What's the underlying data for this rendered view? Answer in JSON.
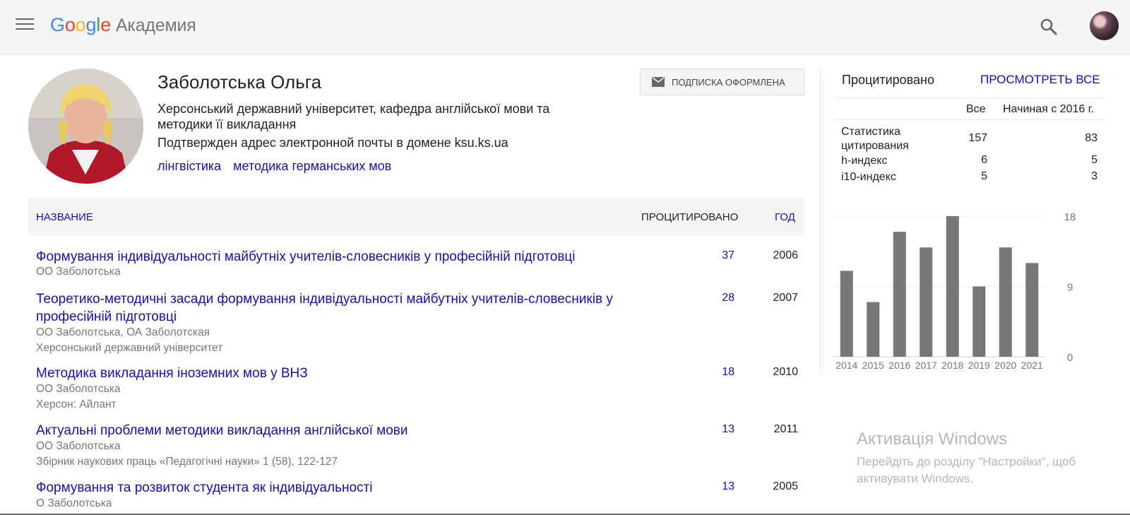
{
  "header": {
    "logo_google": [
      "G",
      "o",
      "o",
      "g",
      "l",
      "e"
    ],
    "logo_colors": [
      "#4285f4",
      "#ea4335",
      "#fbbc05",
      "#4285f4",
      "#34a853",
      "#ea4335"
    ],
    "logo_sub": "Академия",
    "menu_icon": "menu-icon",
    "search_icon": "search-icon"
  },
  "profile": {
    "name": "Заболотська Ольга",
    "affiliation": "Херсонський державний університет, кафедра англійської мови та методики її викладання",
    "email_verified": "Подтвержден адрес электронной почты в домене ksu.ks.ua",
    "interests": [
      "лінгвістика",
      "методика германських мов"
    ],
    "follow_label": "ПОДПИСКА ОФОРМЛЕНА"
  },
  "table": {
    "headers": {
      "title": "НАЗВАНИЕ",
      "cited": "ПРОЦИТИРОВАНО",
      "year": "ГОД"
    },
    "rows": [
      {
        "title": "Формування індивідуальності майбутніх учителів-словесників у професійній підготовці",
        "authors": "ОО Заболотська",
        "source": "",
        "cites": "37",
        "year": "2006"
      },
      {
        "title": "Теоретико-методичні засади формування індивідуальності майбутніх учителів-словесників у професійній підготовці",
        "authors": "ОО Заболотська, ОА Заболотская",
        "source": "Херсонський державний університет",
        "cites": "28",
        "year": "2007"
      },
      {
        "title": "Методика викладання іноземних мов у ВНЗ",
        "authors": "ОО Заболотська",
        "source": "Херсон: Айлант",
        "cites": "18",
        "year": "2010"
      },
      {
        "title": "Актуальні проблеми методики викладання англійської мови",
        "authors": "ОО Заболотська",
        "source": "Збірник наукових праць «Педагогічні науки» 1 (58), 122-127",
        "cites": "13",
        "year": "2011"
      },
      {
        "title": "Формування та розвиток студента як індивідуальності",
        "authors": "О Заболотська",
        "source": "",
        "cites": "13",
        "year": "2005"
      }
    ]
  },
  "citations": {
    "heading": "Процитировано",
    "view_all": "ПРОСМОТРЕТЬ ВСЕ",
    "col_all": "Все",
    "col_since": "Начиная с 2016 г.",
    "rows": [
      {
        "label": "Статистика цитирования",
        "all": "157",
        "since": "83"
      },
      {
        "label": "h-индекс",
        "all": "6",
        "since": "5"
      },
      {
        "label": "i10-индекс",
        "all": "5",
        "since": "3"
      }
    ]
  },
  "chart_data": {
    "type": "bar",
    "categories": [
      "2014",
      "2015",
      "2016",
      "2017",
      "2018",
      "2019",
      "2020",
      "2021"
    ],
    "values": [
      11,
      7,
      16,
      14,
      18,
      9,
      14,
      12
    ],
    "yticks": [
      "18",
      "9",
      "0"
    ],
    "ylim": [
      0,
      18
    ],
    "bar_color": "#777777",
    "grid": true
  },
  "windows_watermark": {
    "title": "Активація Windows",
    "subtitle": "Перейдіть до розділу \"Настройки\", щоб активувати Windows."
  }
}
